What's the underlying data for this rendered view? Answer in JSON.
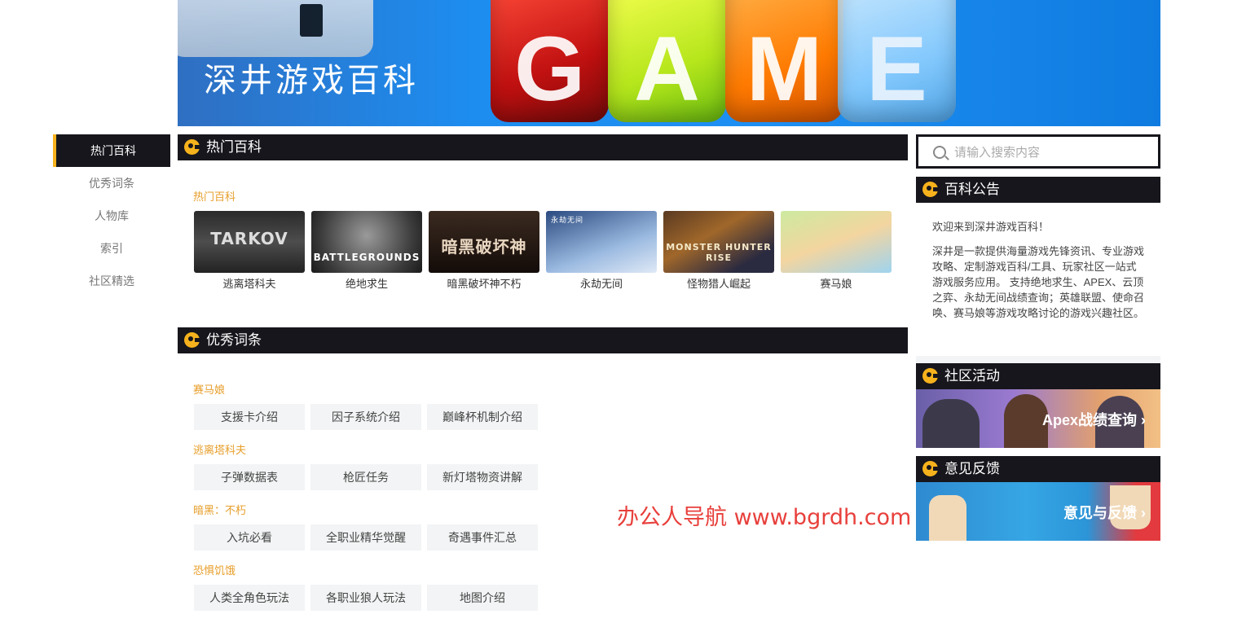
{
  "banner": {
    "title": "深井游戏百科",
    "cube_letters": [
      "G",
      "A",
      "M",
      "E"
    ]
  },
  "leftnav": {
    "items": [
      {
        "label": "热门百科"
      },
      {
        "label": "优秀词条"
      },
      {
        "label": "人物库"
      },
      {
        "label": "索引"
      },
      {
        "label": "社区精选"
      }
    ]
  },
  "hot": {
    "header": "热门百科",
    "subtitle": "热门百科",
    "games": [
      {
        "name": "逃离塔科夫",
        "thumb_text": "TARKOV"
      },
      {
        "name": "绝地求生",
        "thumb_text": "BATTLEGROUNDS"
      },
      {
        "name": "暗黑破坏神不朽",
        "thumb_text": "暗黑破坏神"
      },
      {
        "name": "永劫无间",
        "thumb_text": "永劫无间"
      },
      {
        "name": "怪物猎人崛起",
        "thumb_text": "MONSTER HUNTER RISE"
      },
      {
        "name": "赛马娘",
        "thumb_text": ""
      }
    ]
  },
  "entries": {
    "header": "优秀词条",
    "groups": [
      {
        "title": "赛马娘",
        "tags": [
          "支援卡介绍",
          "因子系统介绍",
          "巅峰杯机制介绍"
        ]
      },
      {
        "title": "逃离塔科夫",
        "tags": [
          "子弹数据表",
          "枪匠任务",
          "新灯塔物资讲解"
        ]
      },
      {
        "title": "暗黑：不朽",
        "tags": [
          "入坑必看",
          "全职业精华觉醒",
          "奇遇事件汇总"
        ]
      },
      {
        "title": "恐惧饥饿",
        "tags": [
          "人类全角色玩法",
          "各职业狼人玩法",
          "地图介绍"
        ]
      }
    ]
  },
  "search": {
    "placeholder": "请输入搜索内容"
  },
  "notice": {
    "header": "百科公告",
    "welcome": "欢迎来到深井游戏百科！",
    "body": "深井是一款提供海量游戏先锋资讯、专业游戏攻略、定制游戏百科/工具、玩家社区一站式游戏服务应用。 支持绝地求生、APEX、云顶之弈、永劫无间战绩查询；英雄联盟、使命召唤、赛马娘等游戏攻略讨论的游戏兴趣社区。"
  },
  "community": {
    "header": "社区活动",
    "promo_text": "Apex战绩查询 ›"
  },
  "feedback": {
    "header": "意见反馈",
    "promo_text": "意见与反馈 ›"
  },
  "watermark": "办公人导航  www.bgrdh.com",
  "colors": {
    "accent": "#f6b21c",
    "dark": "#16161c",
    "subtitle": "#e79e2a",
    "tag_bg": "#f2f4f5"
  }
}
